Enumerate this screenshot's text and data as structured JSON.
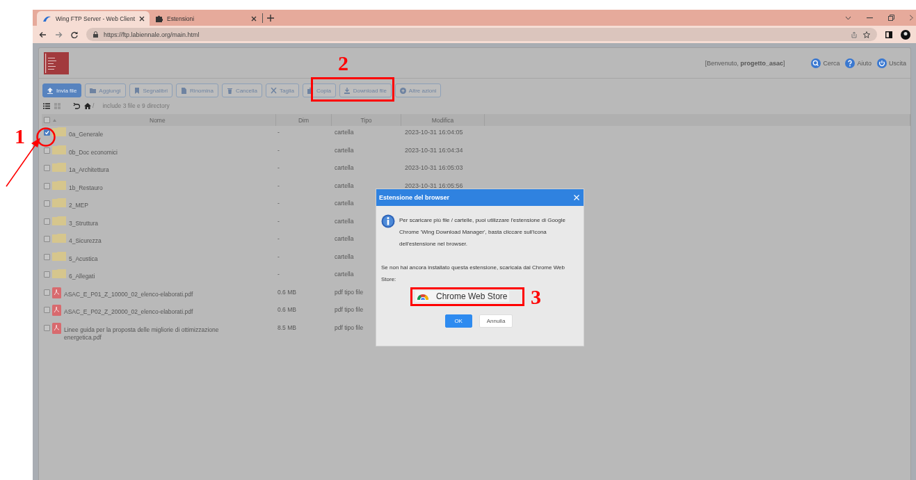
{
  "browser": {
    "tabs": [
      {
        "title": "Wing FTP Server - Web Client",
        "selected": true,
        "kind": "wing"
      },
      {
        "title": "Estensioni",
        "selected": false,
        "kind": "puzzle"
      }
    ],
    "url": "https://ftp.labiennale.org/main.html"
  },
  "header": {
    "welcome": "[Benvenuto, **progetto_asac**]",
    "links": [
      {
        "label": "Cerca",
        "kind": "search"
      },
      {
        "label": "Aiuto",
        "kind": "help"
      },
      {
        "label": "Uscita",
        "kind": "power"
      }
    ]
  },
  "toolbar": [
    {
      "label": "Invia file",
      "kind": "primary"
    },
    {
      "label": "Aggiungi",
      "kind": "default"
    },
    {
      "label": "Segnalibri",
      "kind": "default"
    },
    {
      "label": "Rinomina",
      "kind": "default"
    },
    {
      "label": "Cancella",
      "kind": "default"
    },
    {
      "label": "Taglia",
      "kind": "default"
    },
    {
      "label": "Copia",
      "kind": "default"
    },
    {
      "label": "Download file",
      "kind": "default"
    },
    {
      "label": "Altre azioni",
      "kind": "default"
    }
  ],
  "path": {
    "root": "/",
    "summary": "include 3 file e 9 directory"
  },
  "table": {
    "select_all_checked": false,
    "columns": [
      "Nome",
      "Dim",
      "Tipo",
      "Modifica"
    ],
    "rows": [
      {
        "name": "0a_Generale",
        "size": "-",
        "type": "cartella",
        "modified": "2023-10-31 16:04:05",
        "kind": "folder",
        "checked": true
      },
      {
        "name": "0b_Doc economici",
        "size": "-",
        "type": "cartella",
        "modified": "2023-10-31 16:04:34",
        "kind": "folder",
        "checked": false
      },
      {
        "name": "1a_Architettura",
        "size": "-",
        "type": "cartella",
        "modified": "2023-10-31 16:05:03",
        "kind": "folder",
        "checked": false
      },
      {
        "name": "1b_Restauro",
        "size": "-",
        "type": "cartella",
        "modified": "2023-10-31 16:05:56",
        "kind": "folder",
        "checked": false
      },
      {
        "name": "2_MEP",
        "size": "-",
        "type": "cartella",
        "kind": "folder",
        "checked": false
      },
      {
        "name": "3_Struttura",
        "size": "-",
        "type": "cartella",
        "kind": "folder",
        "checked": false
      },
      {
        "name": "4_Sicurezza",
        "size": "-",
        "type": "cartella",
        "kind": "folder",
        "checked": false
      },
      {
        "name": "5_Acustica",
        "size": "-",
        "type": "cartella",
        "kind": "folder",
        "checked": false
      },
      {
        "name": "6_Allegati",
        "size": "-",
        "type": "cartella",
        "kind": "folder",
        "checked": false
      },
      {
        "name": "ASAC_E_P01_Z_10000_02_elenco-elaborati.pdf",
        "size": "0.6 MB",
        "type": "pdf tipo file",
        "kind": "pdf",
        "checked": false
      },
      {
        "name": "ASAC_E_P02_Z_20000_02_elenco-elaborati.pdf",
        "size": "0.6 MB",
        "type": "pdf tipo file",
        "kind": "pdf",
        "checked": false
      },
      {
        "name": "Linee guida per la proposta delle migliorie di ottimizzazione energetica.pdf",
        "size": "8.5 MB",
        "type": "pdf tipo file",
        "kind": "pdf",
        "checked": false
      }
    ]
  },
  "dialog": {
    "title": "Estensione del browser",
    "message": "Per scaricare più file / cartelle, puoi utilizzare l'estensione di Google Chrome 'Wing Download Manager', basta cliccare sull'icona dell'estensione nel browser.",
    "store_text": "Se non hai ancora installato questa estensione, scaricala dal Chrome Web Store:",
    "store_link": "Chrome Web Store",
    "buttons": [
      {
        "label": "OK",
        "kind": "primary"
      },
      {
        "label": "Annulla",
        "kind": "default"
      }
    ]
  },
  "annotations": [
    "1",
    "2",
    "3"
  ]
}
